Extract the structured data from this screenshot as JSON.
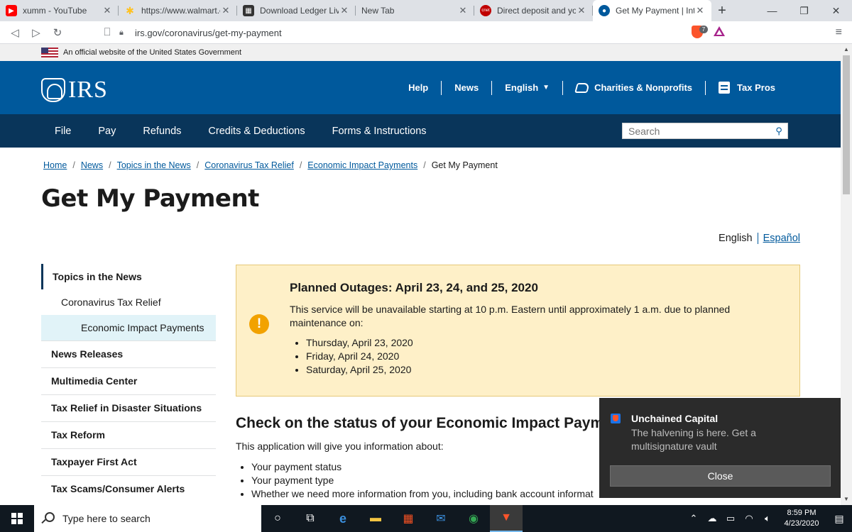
{
  "browser": {
    "tabs": [
      {
        "title": "xumm - YouTube",
        "icon": "youtube-icon",
        "color": "#ff0000"
      },
      {
        "title": "https://www.walmart.com",
        "icon": "walmart-icon",
        "color": "#ffc220"
      },
      {
        "title": "Download Ledger Live",
        "icon": "ledger-icon",
        "color": "#333333"
      },
      {
        "title": "New Tab",
        "icon": "",
        "color": ""
      },
      {
        "title": "Direct deposit and you",
        "icon": "cnet-icon",
        "color": "#c00000"
      },
      {
        "title": "Get My Payment | Inte",
        "icon": "irs-icon",
        "color": "#00599c"
      }
    ],
    "url": "irs.gov/coronavirus/get-my-payment",
    "brave_badge": "7"
  },
  "gov_banner": "An official website of the United States Government",
  "header": {
    "logo": "IRS",
    "util_nav": [
      "Help",
      "News",
      "English",
      "Charities & Nonprofits",
      "Tax Pros"
    ]
  },
  "main_nav": [
    "File",
    "Pay",
    "Refunds",
    "Credits & Deductions",
    "Forms & Instructions"
  ],
  "search": {
    "placeholder": "Search"
  },
  "breadcrumbs": [
    "Home",
    "News",
    "Topics in the News",
    "Coronavirus Tax Relief",
    "Economic Impact Payments",
    "Get My Payment"
  ],
  "page_title": "Get My Payment",
  "languages": {
    "english": "English",
    "spanish": "Español"
  },
  "sidebar": {
    "heading": "Topics in the News",
    "sub1": "Coronavirus Tax Relief",
    "sub2": "Economic Impact Payments",
    "items": [
      "News Releases",
      "Multimedia Center",
      "Tax Relief in Disaster Situations",
      "Tax Reform",
      "Taxpayer First Act",
      "Tax Scams/Consumer Alerts"
    ]
  },
  "alert": {
    "title": "Planned Outages: April 23, 24, and 25, 2020",
    "message": "This service will be unavailable starting at 10 p.m. Eastern until approximately 1 a.m. due to planned maintenance on:",
    "dates": [
      "Thursday, April 23, 2020",
      "Friday, April 24, 2020",
      "Saturday, April 25, 2020"
    ]
  },
  "status_section": {
    "heading": "Check on the status of your Economic Impact Payme",
    "intro": "This application will give you information about:",
    "bullets": [
      "Your payment status",
      "Your payment type",
      "Whether we need more information from you, including bank account informat"
    ]
  },
  "toast": {
    "title": "Unchained Capital",
    "body": "The halvening is here. Get a multisignature vault",
    "button": "Close"
  },
  "taskbar": {
    "search_placeholder": "Type here to search",
    "time": "8:59 PM",
    "date": "4/23/2020"
  }
}
